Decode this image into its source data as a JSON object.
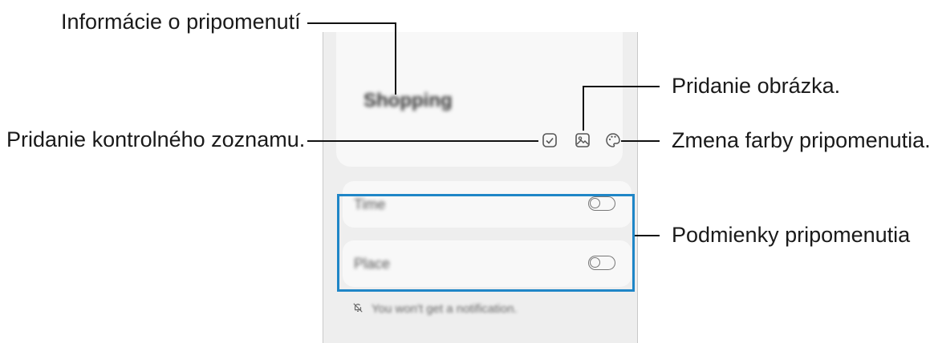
{
  "callouts": {
    "reminder_info": "Informácie o pripomenutí",
    "add_checklist": "Pridanie kontrolného zoznamu.",
    "add_image": "Pridanie obrázka.",
    "change_color": "Zmena farby pripomenutia.",
    "conditions": "Podmienky pripomenutia"
  },
  "screen": {
    "title": "Shopping",
    "conditions": [
      {
        "label": "Time",
        "enabled": false
      },
      {
        "label": "Place",
        "enabled": false
      }
    ],
    "notification_text": "You won't get a notification."
  },
  "icons": [
    "checkbox-icon",
    "image-icon",
    "palette-icon",
    "bell-off-icon"
  ],
  "colors": {
    "highlight": "#1f86c7"
  }
}
